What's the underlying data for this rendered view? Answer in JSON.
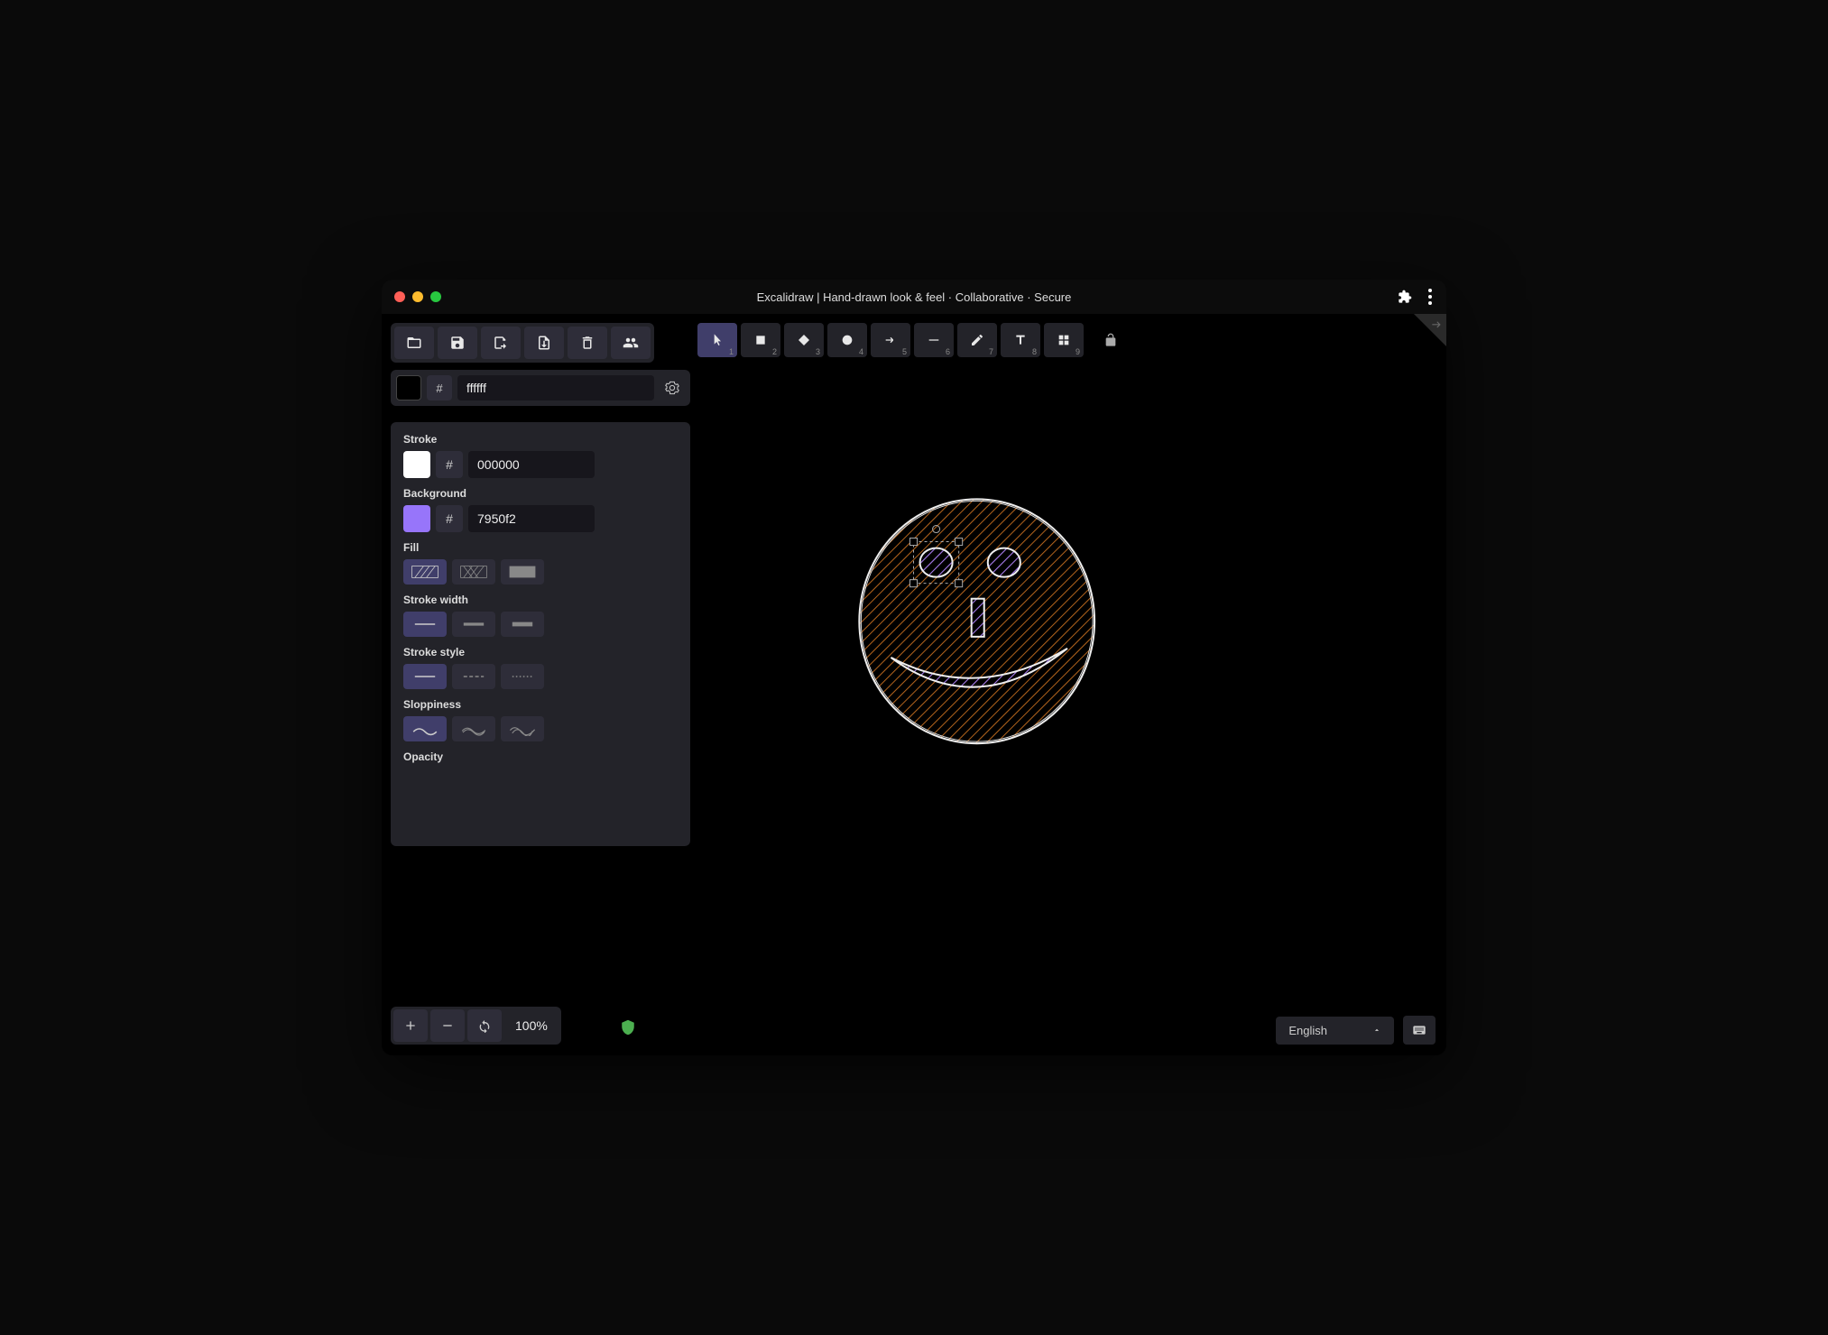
{
  "window": {
    "title": "Excalidraw | Hand-drawn look & feel · Collaborative · Secure"
  },
  "file_toolbar": [
    {
      "name": "open",
      "icon": "folder-open"
    },
    {
      "name": "save",
      "icon": "save"
    },
    {
      "name": "clear",
      "icon": "eraser"
    },
    {
      "name": "export",
      "icon": "export"
    },
    {
      "name": "delete",
      "icon": "trash"
    },
    {
      "name": "collaborate",
      "icon": "users"
    }
  ],
  "shape_toolbar": [
    {
      "name": "selection",
      "icon": "pointer",
      "key": "1",
      "selected": true
    },
    {
      "name": "rectangle",
      "icon": "square",
      "key": "2"
    },
    {
      "name": "diamond",
      "icon": "diamond",
      "key": "3"
    },
    {
      "name": "ellipse",
      "icon": "circle",
      "key": "4"
    },
    {
      "name": "arrow",
      "icon": "arrow",
      "key": "5"
    },
    {
      "name": "line",
      "icon": "line",
      "key": "6"
    },
    {
      "name": "draw",
      "icon": "pencil",
      "key": "7"
    },
    {
      "name": "text",
      "icon": "text",
      "key": "8"
    },
    {
      "name": "library",
      "icon": "grid",
      "key": "9"
    }
  ],
  "canvas_color": {
    "hash": "#",
    "value": "ffffff",
    "swatch": "#000000"
  },
  "props": {
    "stroke": {
      "label": "Stroke",
      "hash": "#",
      "value": "000000",
      "swatch": "#ffffff"
    },
    "background": {
      "label": "Background",
      "hash": "#",
      "value": "7950f2",
      "swatch": "#9775fa"
    },
    "fill": {
      "label": "Fill",
      "options": [
        "hachure",
        "cross",
        "solid"
      ],
      "selected": 0
    },
    "stroke_width": {
      "label": "Stroke width",
      "options": [
        "thin",
        "medium",
        "thick"
      ],
      "selected": 0
    },
    "stroke_style": {
      "label": "Stroke style",
      "options": [
        "solid",
        "dashed",
        "dotted"
      ],
      "selected": 0
    },
    "sloppiness": {
      "label": "Sloppiness",
      "options": [
        "architect",
        "artist",
        "cartoonist"
      ],
      "selected": 0
    },
    "opacity": {
      "label": "Opacity"
    }
  },
  "footer": {
    "zoom": "100%",
    "language": "English"
  }
}
